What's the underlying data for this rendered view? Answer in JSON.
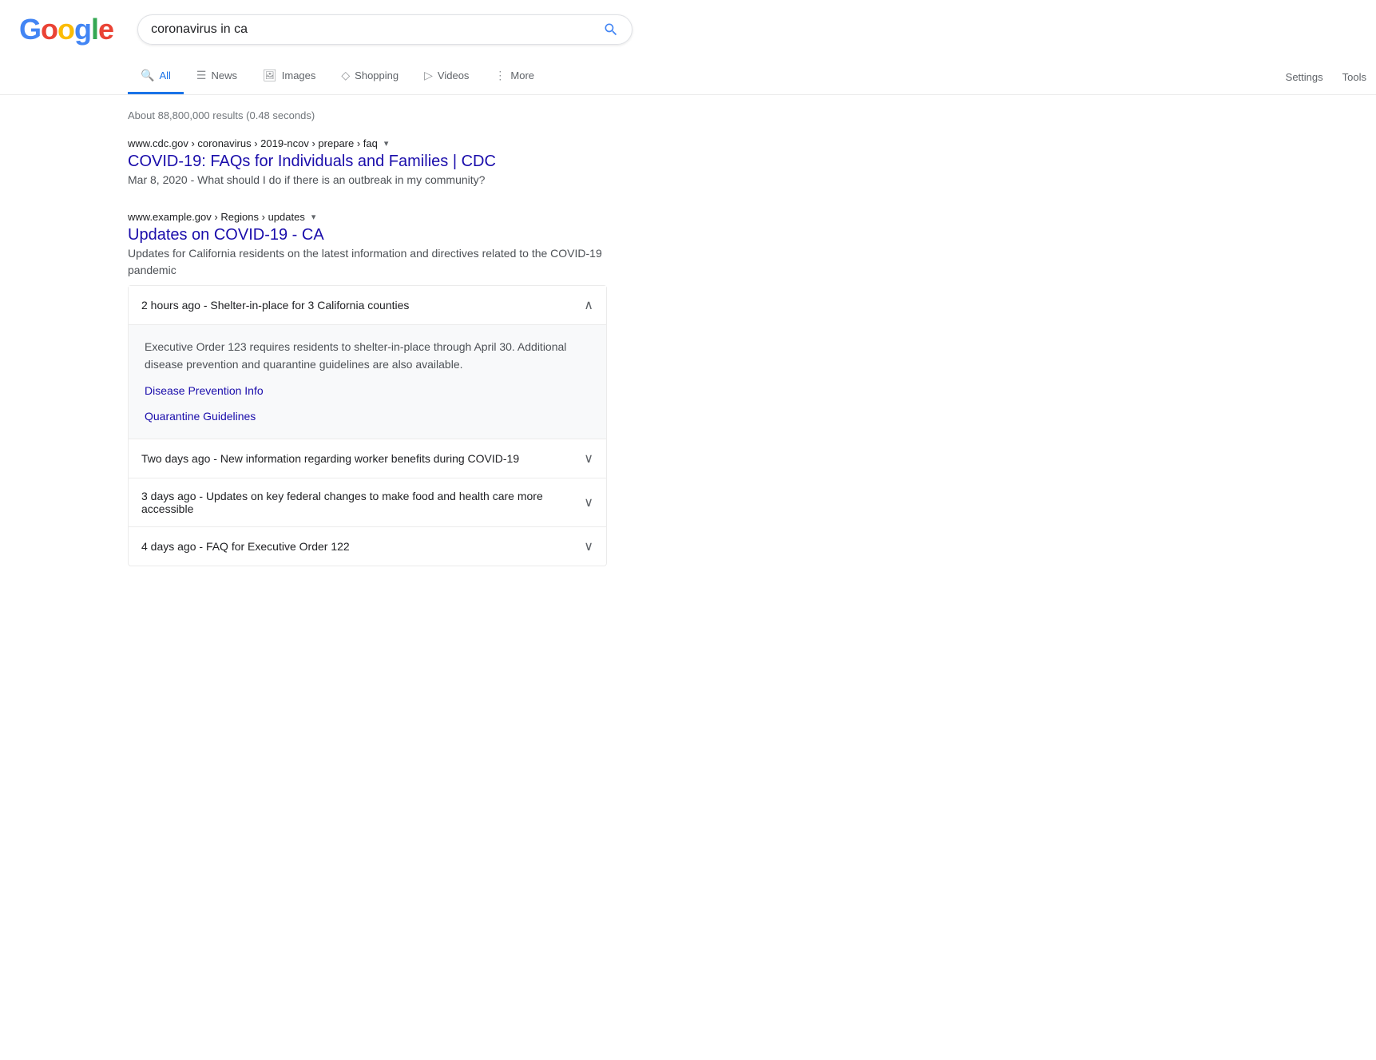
{
  "header": {
    "logo": {
      "letters": [
        {
          "char": "G",
          "class": "g"
        },
        {
          "char": "o",
          "class": "o1"
        },
        {
          "char": "o",
          "class": "o2"
        },
        {
          "char": "g",
          "class": "g2"
        },
        {
          "char": "l",
          "class": "l"
        },
        {
          "char": "e",
          "class": "e"
        }
      ]
    },
    "search_value": "coronavirus in ca",
    "search_placeholder": "Search"
  },
  "nav": {
    "tabs": [
      {
        "id": "all",
        "label": "All",
        "icon": "🔍",
        "active": true
      },
      {
        "id": "news",
        "label": "News",
        "icon": "☰"
      },
      {
        "id": "images",
        "label": "Images",
        "icon": "🖼"
      },
      {
        "id": "shopping",
        "label": "Shopping",
        "icon": "◇"
      },
      {
        "id": "videos",
        "label": "Videos",
        "icon": "▷"
      },
      {
        "id": "more",
        "label": "More",
        "icon": "⋮"
      }
    ],
    "settings_label": "Settings",
    "tools_label": "Tools"
  },
  "results": {
    "count_text": "About 88,800,000 results (0.48 seconds)",
    "items": [
      {
        "id": "result-1",
        "url": "www.cdc.gov › coronavirus › 2019-ncov › prepare › faq",
        "title": "COVID-19: FAQs for Individuals and Families | CDC",
        "date": "Mar 8, 2020",
        "description": "What should I do if there is an outbreak in my community?",
        "has_dropdown": true
      },
      {
        "id": "result-2",
        "url": "www.example.gov › Regions › updates",
        "title": "Updates on COVID-19 - CA",
        "description": "Updates for California residents on the latest information and directives related to the COVID-19 pandemic",
        "has_dropdown": true,
        "updates": [
          {
            "id": "update-1",
            "time_text": "2 hours ago - Shelter-in-place for 3 California counties",
            "expanded": true,
            "content": "Executive Order 123 requires residents to shelter-in-place through April 30. Additional disease prevention and quarantine guidelines are also available.",
            "links": [
              {
                "label": "Disease Prevention Info",
                "href": "#"
              },
              {
                "label": "Quarantine Guidelines",
                "href": "#"
              }
            ]
          },
          {
            "id": "update-2",
            "time_text": "Two days ago - New information regarding worker benefits during COVID-19",
            "expanded": false,
            "content": "",
            "links": []
          },
          {
            "id": "update-3",
            "time_text": "3 days ago - Updates on key federal changes to make food and health care more accessible",
            "expanded": false,
            "content": "",
            "links": []
          },
          {
            "id": "update-4",
            "time_text": "4 days ago - FAQ for Executive Order 122",
            "expanded": false,
            "content": "",
            "links": []
          }
        ]
      }
    ]
  }
}
